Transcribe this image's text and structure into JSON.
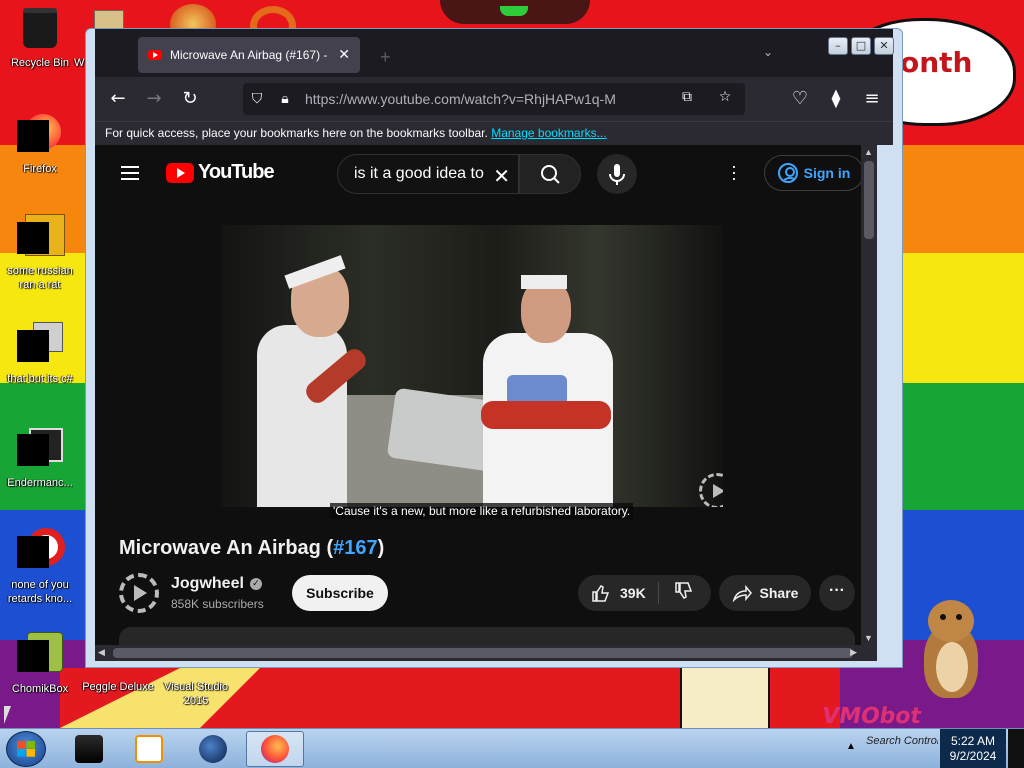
{
  "desktop": {
    "speech_bubble_text": "onth",
    "vm_logo": "VMObot",
    "icons": [
      {
        "label": "Recycle Bin",
        "icon": "recycle-bin-icon"
      },
      {
        "label": "Firefox",
        "icon": "firefox-icon"
      },
      {
        "label": "some russian ran a rat",
        "icon": "app-icon"
      },
      {
        "label": "that but its c#",
        "icon": "folder-icon"
      },
      {
        "label": "Endermanc...",
        "icon": "window-icon"
      },
      {
        "label": "none of you retards kno...",
        "icon": "opera-icon"
      },
      {
        "label": "ChomikBox",
        "icon": "chomikbox-icon"
      },
      {
        "label": "Peggle Deluxe",
        "icon": "game-icon"
      },
      {
        "label": "Visual Studio 2015",
        "icon": "visual-studio-icon"
      }
    ],
    "partial_label_w": "W"
  },
  "browser": {
    "tab": {
      "title": "Microwave An Airbag (#167) - ",
      "favicon": "youtube-favicon"
    },
    "new_tab_glyph": "+",
    "url": "https://www.youtube.com/watch?v=RhjHAPw1q-M",
    "bookmarks_text": "For quick access, place your bookmarks here on the bookmarks toolbar.",
    "bookmarks_link": "Manage bookmarks..."
  },
  "youtube": {
    "logo_text": "YouTube",
    "search_query": "is it a good idea to microwave an airbag",
    "sign_in": "Sign in",
    "caption": "'Cause it's a new, but more like a refurbished laboratory.",
    "video_title": "Microwave An Airbag (",
    "video_tag": "#167",
    "video_title_end": ")",
    "channel_name": "Jogwheel",
    "subscribers": "858K subscribers",
    "subscribe_label": "Subscribe",
    "likes": "39K",
    "share_label": "Share",
    "colors": {
      "accent": "#3ea6ff",
      "brand_red": "#ff0000",
      "bg": "#0f0f0f"
    }
  },
  "taskbar": {
    "tray_text": "Search Control",
    "time": "5:22 AM",
    "date": "9/2/2024",
    "pinned": [
      "explorer-icon",
      "media-player-icon",
      "globe-icon",
      "firefox-icon"
    ]
  }
}
